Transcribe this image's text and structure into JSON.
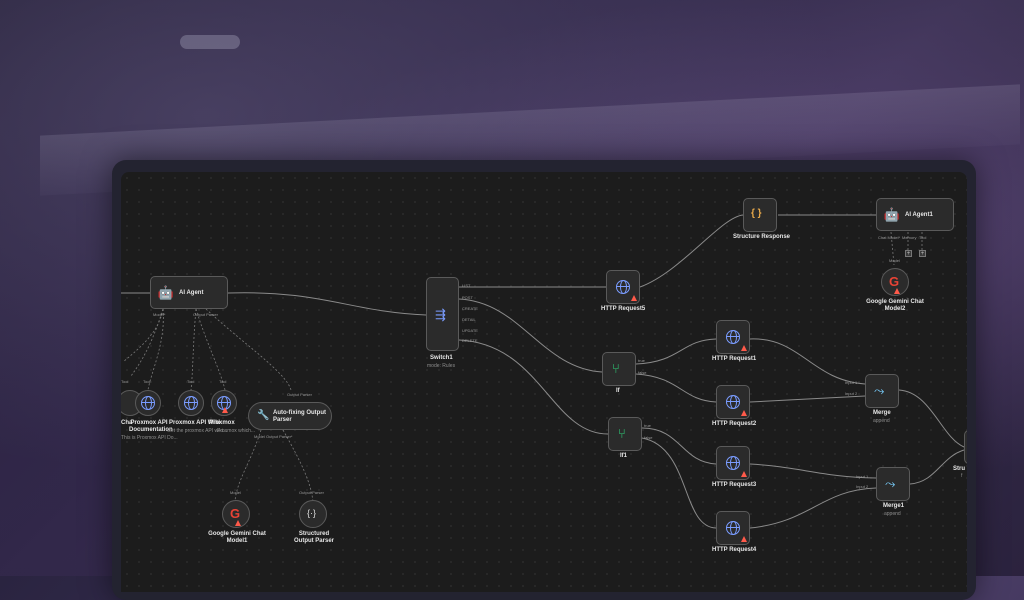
{
  "canvas": {
    "nodes": {
      "ai_agent": {
        "label": "AI Agent",
        "ports": {
          "model": "Model*",
          "output_parser": "Output Parser"
        }
      },
      "ai_agent1": {
        "label": "AI Agent1",
        "ports": {
          "chat_model": "Chat Model*",
          "memory": "Memory",
          "tool": "Tool"
        }
      },
      "structure_response": {
        "label": "Structure Response",
        "icon": "{ }"
      },
      "switch1": {
        "label": "Switch1",
        "sub": "mode: Rules",
        "outputs": [
          "LIST",
          "POST",
          "CREATE",
          "DETAIL",
          "UPDATE",
          "DELETE"
        ]
      },
      "http5": {
        "label": "HTTP Request5"
      },
      "http1": {
        "label": "HTTP Request1"
      },
      "http2": {
        "label": "HTTP Request2"
      },
      "http3": {
        "label": "HTTP Request3"
      },
      "http4": {
        "label": "HTTP Request4"
      },
      "if": {
        "label": "If",
        "outputs": [
          "true",
          "false"
        ]
      },
      "if1": {
        "label": "If1",
        "outputs": [
          "true",
          "false"
        ]
      },
      "merge": {
        "label": "Merge",
        "sub": "append",
        "inputs": [
          "Input 1",
          "Input 2"
        ]
      },
      "merge1": {
        "label": "Merge1",
        "sub": "append",
        "inputs": [
          "Input 1",
          "Input 2"
        ]
      },
      "gemini2": {
        "label": "Google Gemini Chat Model2",
        "port": "Model"
      },
      "gemini1": {
        "label": "Google Gemini Chat Model1",
        "port": "Model"
      },
      "structured_parser": {
        "label": "Structured Output Parser",
        "port": "Output Parser"
      },
      "autofix_parser": {
        "label": "Auto-fixing Output Parser",
        "top_port": "Output Parser",
        "bottom_ports": "Model   Output Parser*"
      },
      "tool_partial": {
        "label": "Cha",
        "port": "Tool"
      },
      "tool_docs": {
        "label": "Proxmox API Documentation",
        "sub": "This is Proxmox API Do...",
        "port": "Tool"
      },
      "tool_wiki": {
        "label": "Proxmox API Wiki",
        "sub": "Get the proxmox API wiki...",
        "port": "Tool"
      },
      "tool_proxmox": {
        "label": "Proxmox",
        "sub": "Proxmox which...",
        "port": "Tool"
      },
      "partial_right": {
        "label": "Stru",
        "sub": "f"
      }
    }
  },
  "colors": {
    "canvas_bg": "#1c1c1c",
    "node_border": "#5a5a5a",
    "wire": "#8a8a8a",
    "accent_green": "#2fd07a",
    "accent_blue": "#7a9cff",
    "warning": "#ff5a4a",
    "json_orange": "#e8a94a"
  },
  "icons": {
    "ai_agent": "robot-icon",
    "http": "globe-icon",
    "switch": "switch-icon",
    "if": "branch-icon",
    "merge": "merge-icon",
    "gemini": "google-g-icon",
    "parser": "braces-icon",
    "autofix": "wrench-icon",
    "warning": "warning-triangle-icon"
  }
}
